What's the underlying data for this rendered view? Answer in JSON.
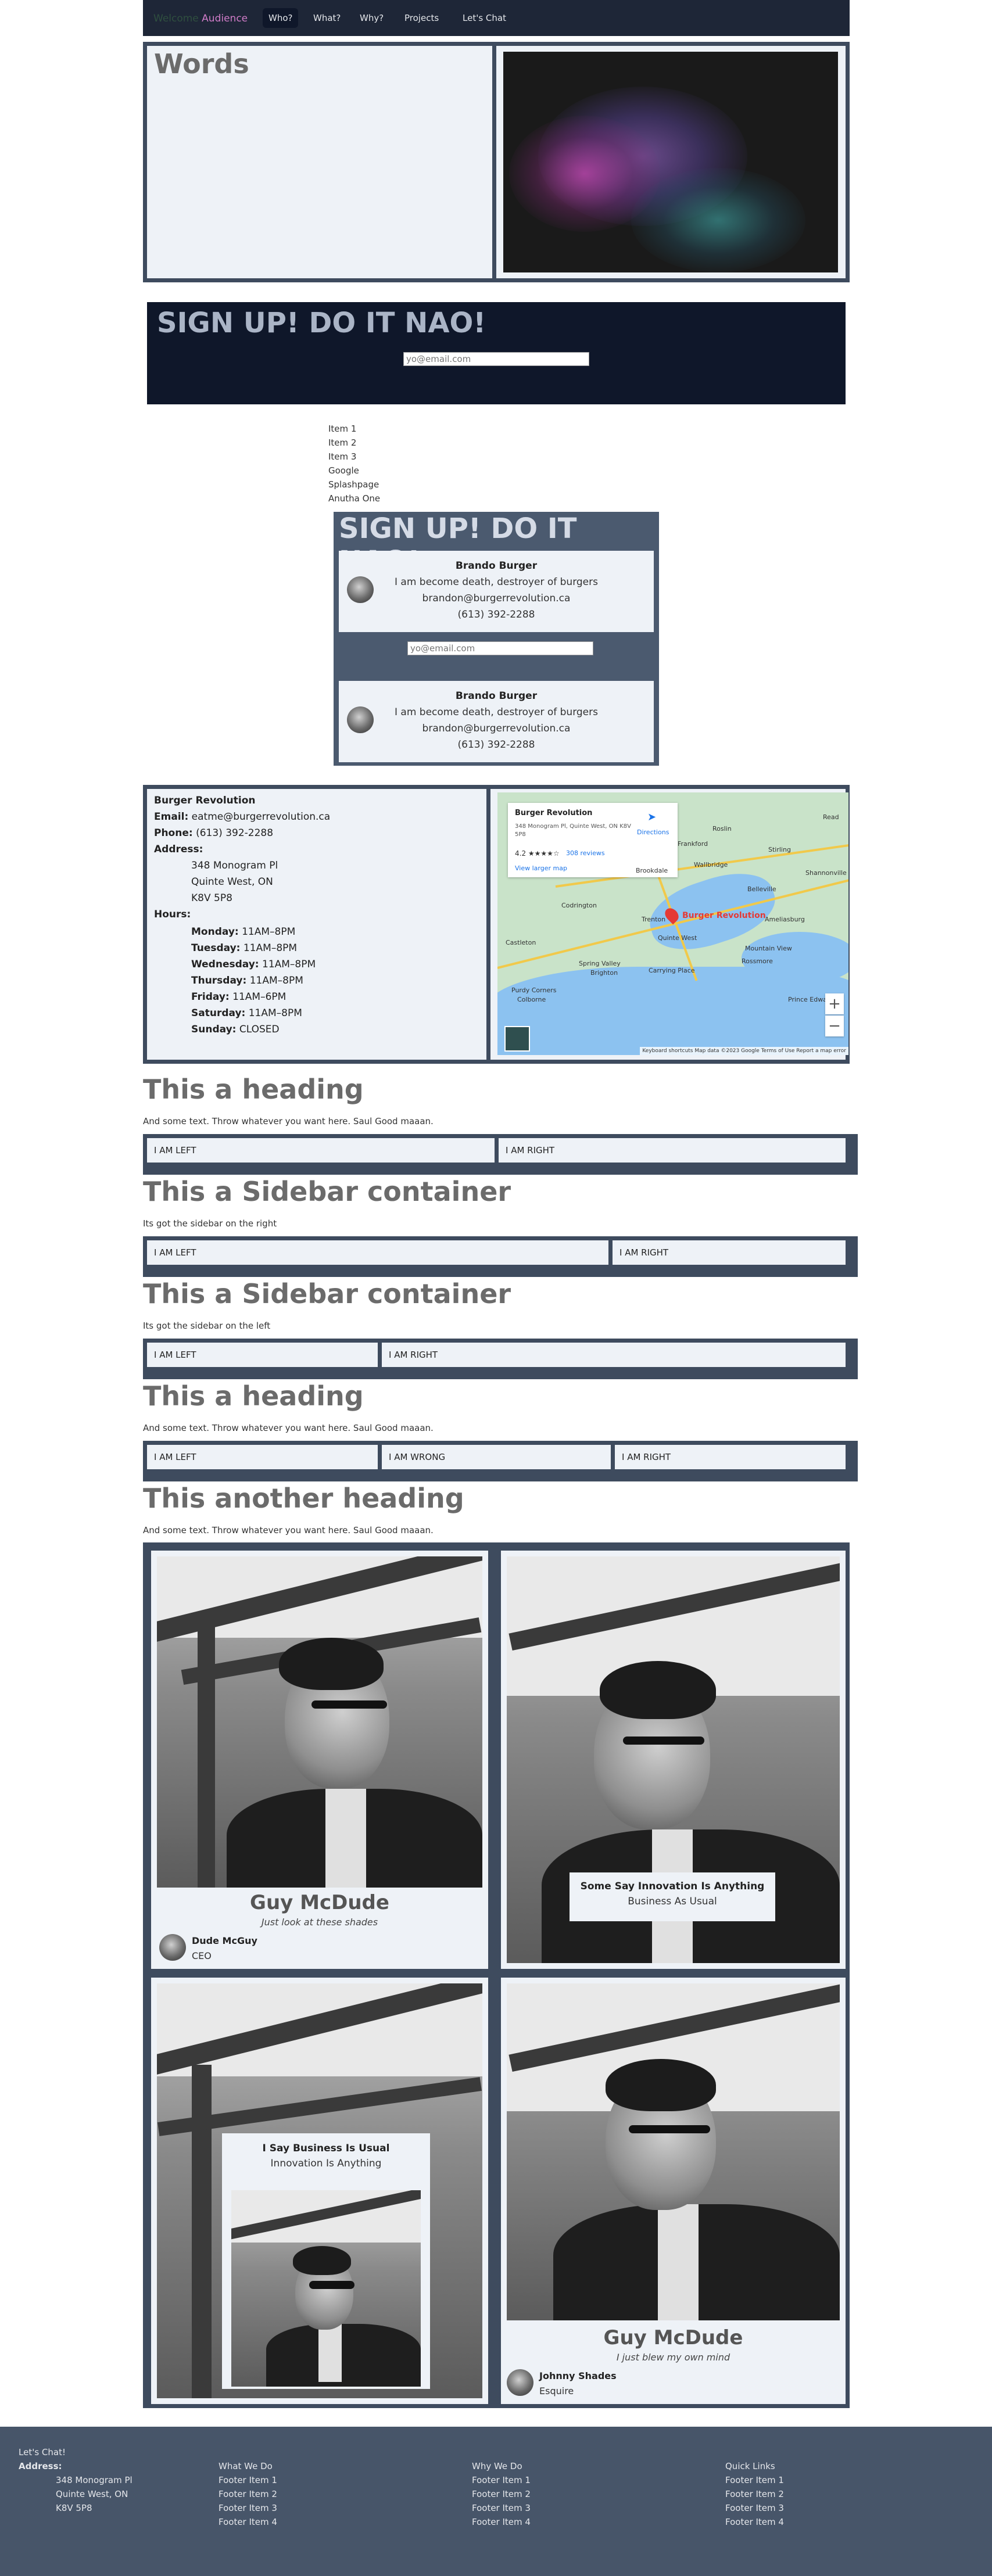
{
  "nav": {
    "logo_part1": "Welcome",
    "logo_part2": "Audience",
    "links": [
      "Who?",
      "What?",
      "Why?",
      "Projects",
      "Let's Chat"
    ],
    "active_index": 0
  },
  "hero": {
    "title": "Words"
  },
  "signup": {
    "title": "SIGN UP! DO IT NAO!",
    "email_placeholder": "yo@email.com"
  },
  "plain_list": [
    "Item 1",
    "Item 2",
    "Item 3",
    "Google",
    "Splashpage",
    "Anutha One"
  ],
  "signup_small": {
    "title": "SIGN UP! DO IT NAO!",
    "email_placeholder": "yo@email.com",
    "person": {
      "name": "Brando Burger",
      "tagline": "I am become death, destroyer of burgers",
      "email": "brandon@burgerrevolution.ca",
      "phone": "(613) 392-2288"
    }
  },
  "contact": {
    "business": "Burger Revolution",
    "email_label": "Email:",
    "email": "eatme@burgerrevolution.ca",
    "phone_label": "Phone:",
    "phone": "(613) 392-2288",
    "address_label": "Address:",
    "address": [
      "348 Monogram Pl",
      "Quinte West, ON",
      "K8V 5P8"
    ],
    "hours_label": "Hours:",
    "hours": [
      {
        "day": "Monday:",
        "time": "11AM–8PM"
      },
      {
        "day": "Tuesday:",
        "time": "11AM–8PM"
      },
      {
        "day": "Wednesday:",
        "time": "11AM–8PM"
      },
      {
        "day": "Thursday:",
        "time": "11AM–8PM"
      },
      {
        "day": "Friday:",
        "time": "11AM–6PM"
      },
      {
        "day": "Saturday:",
        "time": "11AM–8PM"
      },
      {
        "day": "Sunday:",
        "time": "CLOSED"
      }
    ]
  },
  "map": {
    "place_name": "Burger Revolution",
    "place_address": "348 Monogram Pl, Quinte West, ON K8V 5P8",
    "rating": "4.2 ★★★★☆",
    "reviews": "308 reviews",
    "view_larger": "View larger map",
    "directions": "Directions",
    "pin_label": "Burger Revolution",
    "towns": [
      "Stirling",
      "Frankford",
      "Wallbridge",
      "Belleville",
      "Shannonville",
      "Codrington",
      "Brookdale",
      "Trenton",
      "Quinte West",
      "Castleton",
      "Spring Valley",
      "Brighton",
      "Carrying Place",
      "Rossmore",
      "Mountain View",
      "Purdy Corners",
      "Colborne",
      "Prince Edward",
      "Ameliasburg",
      "Read",
      "Roslin"
    ],
    "attribution": "Keyboard shortcuts   Map data ©2023 Google   Terms of Use   Report a map error",
    "zoom_in": "+",
    "zoom_out": "−"
  },
  "sections": [
    {
      "heading": "This a heading",
      "sub": "And some text. Throw whatever you want here. Saul Good maaan.",
      "cells": [
        "I AM LEFT",
        "I AM RIGHT"
      ]
    },
    {
      "heading": "This a Sidebar container",
      "sub": "Its got the sidebar on the right",
      "cells": [
        "I AM LEFT",
        "I AM RIGHT"
      ]
    },
    {
      "heading": "This a Sidebar container",
      "sub": "Its got the sidebar on the left",
      "cells": [
        "I AM LEFT",
        "I AM RIGHT"
      ]
    },
    {
      "heading": "This a heading",
      "sub": "And some text. Throw whatever you want here. Saul Good maaan.",
      "cells": [
        "I AM LEFT",
        "I AM WRONG",
        "I AM RIGHT"
      ]
    },
    {
      "heading": "This another heading",
      "sub": "And some text. Throw whatever you want here. Saul Good maaan."
    }
  ],
  "gallery": {
    "card1": {
      "name": "Guy McDude",
      "quote": "Just look at these shades",
      "sub_name": "Dude McGuy",
      "sub_role": "CEO"
    },
    "card2": {
      "overlay_title": "Some Say Innovation Is Anything",
      "overlay_sub": "Business As Usual"
    },
    "card3": {
      "overlay_title": "I Say Business Is Usual",
      "overlay_sub": "Innovation Is Anything"
    },
    "card4": {
      "name": "Guy McDude",
      "quote": "I just blew my own mind",
      "sub_name": "Johnny Shades",
      "sub_role": "Esquire"
    }
  },
  "footer": {
    "col1_title": "Let's Chat!",
    "col1_address_label": "Address:",
    "col1_address": [
      "348 Monogram Pl",
      "Quinte West, ON",
      "K8V 5P8"
    ],
    "col2_title": "What We Do",
    "col3_title": "Why We Do",
    "col4_title": "Quick Links",
    "items": [
      "Footer Item 1",
      "Footer Item 2",
      "Footer Item 3",
      "Footer Item 4"
    ]
  },
  "colors": {
    "nav_bg": "#1e2637",
    "frame": "#3e4b5e",
    "panel": "#eef2f7",
    "signup_bg": "#0f172a",
    "footer_bg": "#475569",
    "heading_gray": "#6b6b6b"
  }
}
